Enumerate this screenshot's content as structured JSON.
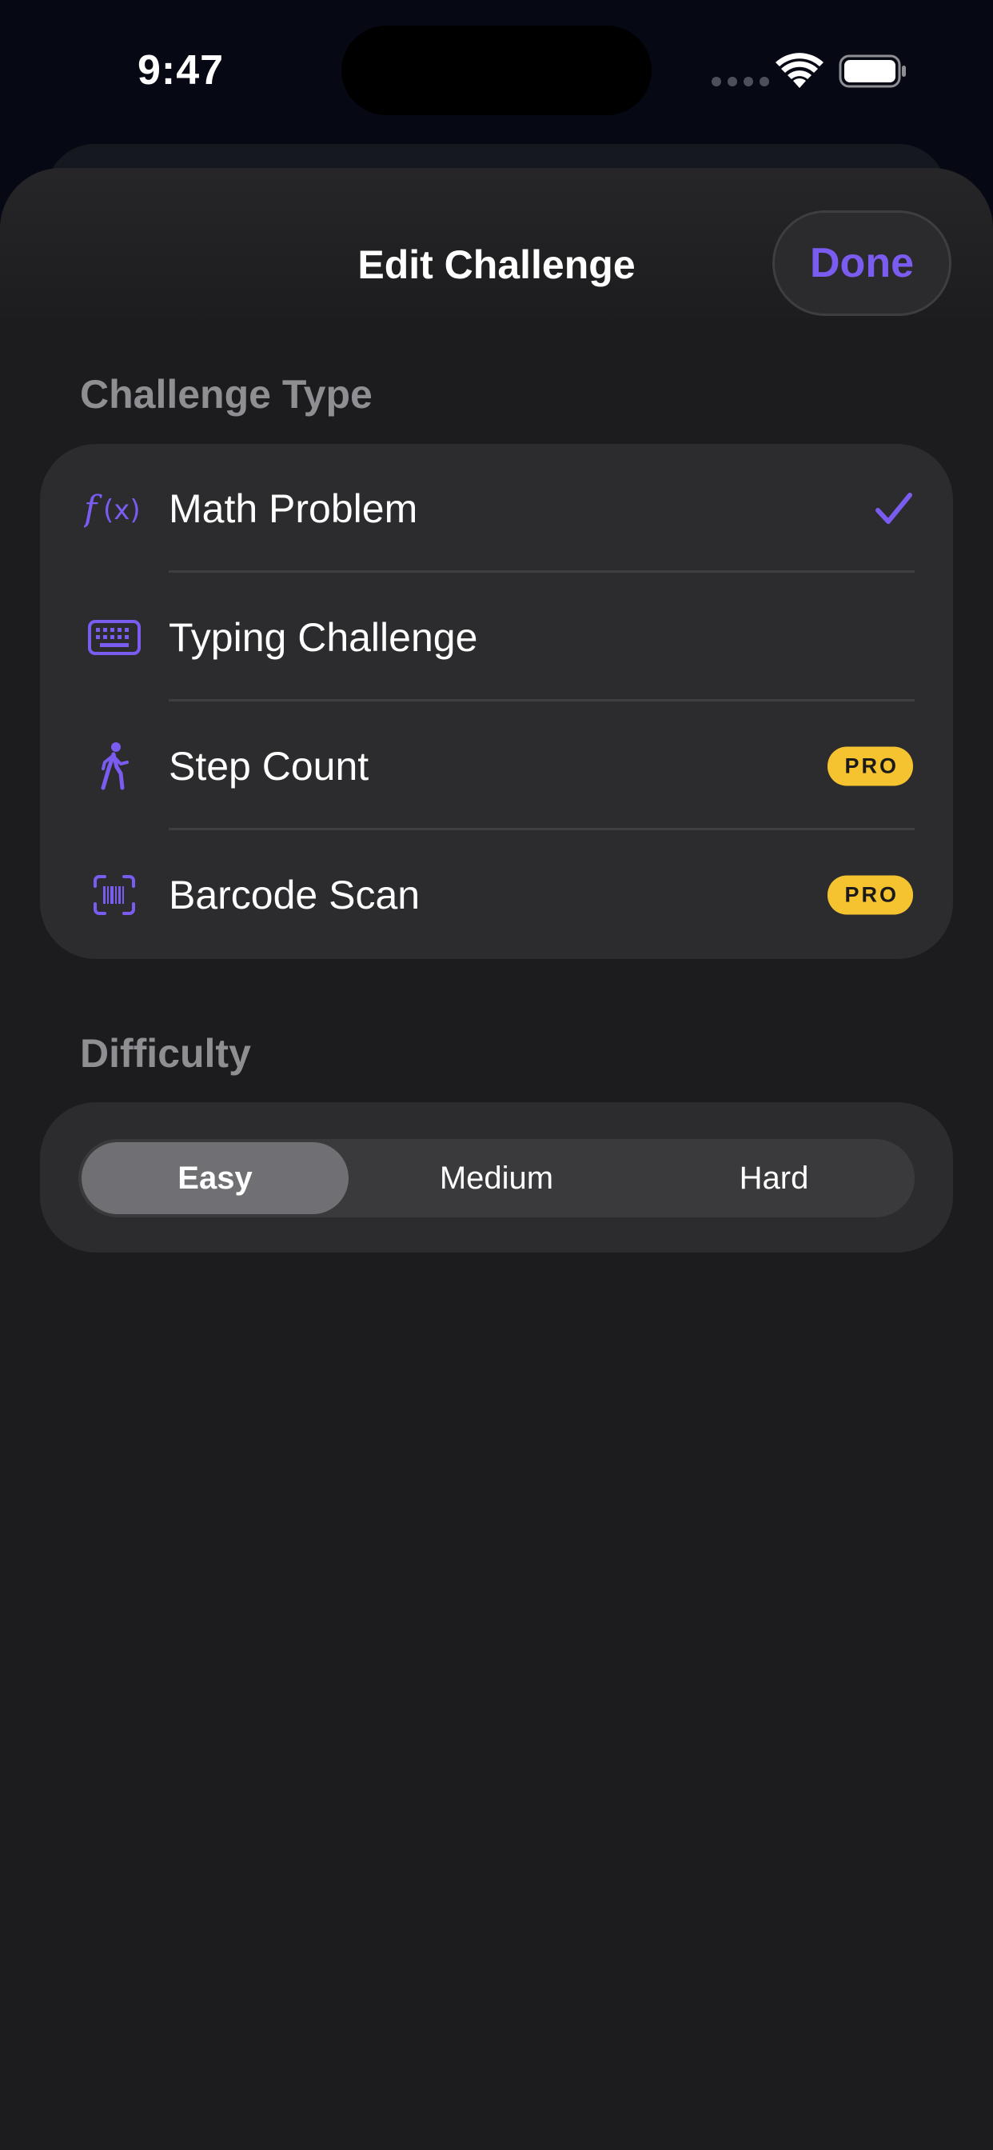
{
  "status_bar": {
    "time": "9:47"
  },
  "sheet": {
    "title": "Edit Challenge",
    "done_label": "Done"
  },
  "challenge_type": {
    "header": "Challenge Type",
    "items": [
      {
        "label": "Math Problem",
        "icon": "function-icon",
        "selected": true,
        "badge": null
      },
      {
        "label": "Typing Challenge",
        "icon": "keyboard-icon",
        "selected": false,
        "badge": null
      },
      {
        "label": "Step Count",
        "icon": "walking-figure-icon",
        "selected": false,
        "badge": "PRO"
      },
      {
        "label": "Barcode Scan",
        "icon": "barcode-viewfinder-icon",
        "selected": false,
        "badge": "PRO"
      }
    ]
  },
  "difficulty": {
    "header": "Difficulty",
    "options": [
      "Easy",
      "Medium",
      "Hard"
    ],
    "selected": "Easy"
  },
  "colors": {
    "accent": "#7b5cf0",
    "pro_badge": "#f6c330",
    "background": "#1c1c1e",
    "group": "#2c2c2e"
  }
}
